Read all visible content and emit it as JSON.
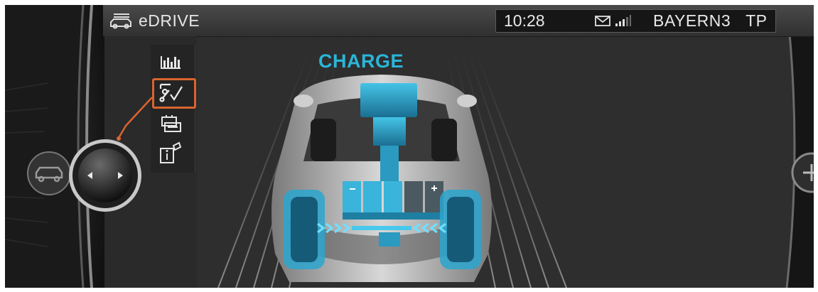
{
  "header": {
    "title": "eDRIVE",
    "title_icon": "car-menu-icon",
    "clock": "10:28",
    "message_icon": "envelope-icon",
    "signal_icon": "signal-strength-icon",
    "station": "BAYERN3",
    "traffic_program": "TP"
  },
  "sidebar": {
    "items": [
      {
        "icon": "consumption-history-icon",
        "selected": false
      },
      {
        "icon": "drive-mode-icon",
        "selected": true
      },
      {
        "icon": "battery-icon",
        "selected": false
      },
      {
        "icon": "info-icon",
        "selected": false
      }
    ]
  },
  "main": {
    "heading": "CHARGE"
  },
  "colors": {
    "accent": "#2ab5d8",
    "highlight": "#d9642e",
    "background": "#2e2e2e"
  }
}
